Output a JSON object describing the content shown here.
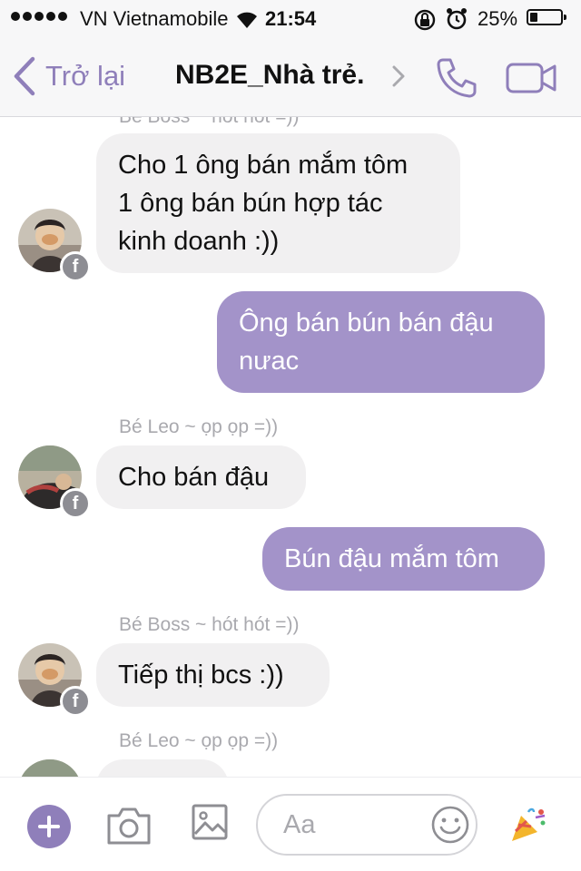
{
  "status_bar": {
    "carrier": "VN Vietnamobile",
    "time": "21:54",
    "battery_percent_label": "25%",
    "battery_level": 0.25
  },
  "header": {
    "back_label": "Trở lại",
    "thread_title": "NB2E_Nhà trẻ."
  },
  "messages": [
    {
      "kind": "partial-name",
      "text": "Bé Boss ~ hót hót =))"
    },
    {
      "kind": "incoming",
      "lines": [
        "Cho 1 ông bán mắm tôm",
        "1 ông bán bún hợp tác",
        "kinh doanh :))"
      ]
    },
    {
      "kind": "outgoing",
      "lines": [
        "Ông bán bún bán đậu",
        "nưac"
      ]
    },
    {
      "kind": "sender",
      "text": "Bé Leo ~ ọp ọp =))"
    },
    {
      "kind": "incoming",
      "lines": [
        "Cho bán đậu"
      ]
    },
    {
      "kind": "outgoing",
      "lines": [
        "Bún đậu mắm tôm"
      ]
    },
    {
      "kind": "sender",
      "text": "Bé Boss ~ hót hót =))"
    },
    {
      "kind": "incoming",
      "lines": [
        "Tiếp thị bcs :))"
      ]
    },
    {
      "kind": "sender",
      "text": "Bé Leo ~ ọp ọp =))"
    }
  ],
  "composer": {
    "placeholder": "Aa"
  },
  "colors": {
    "accent": "#8f7fba",
    "outgoing_bubble": "#a393c9",
    "incoming_bubble": "#f1f0f1"
  }
}
